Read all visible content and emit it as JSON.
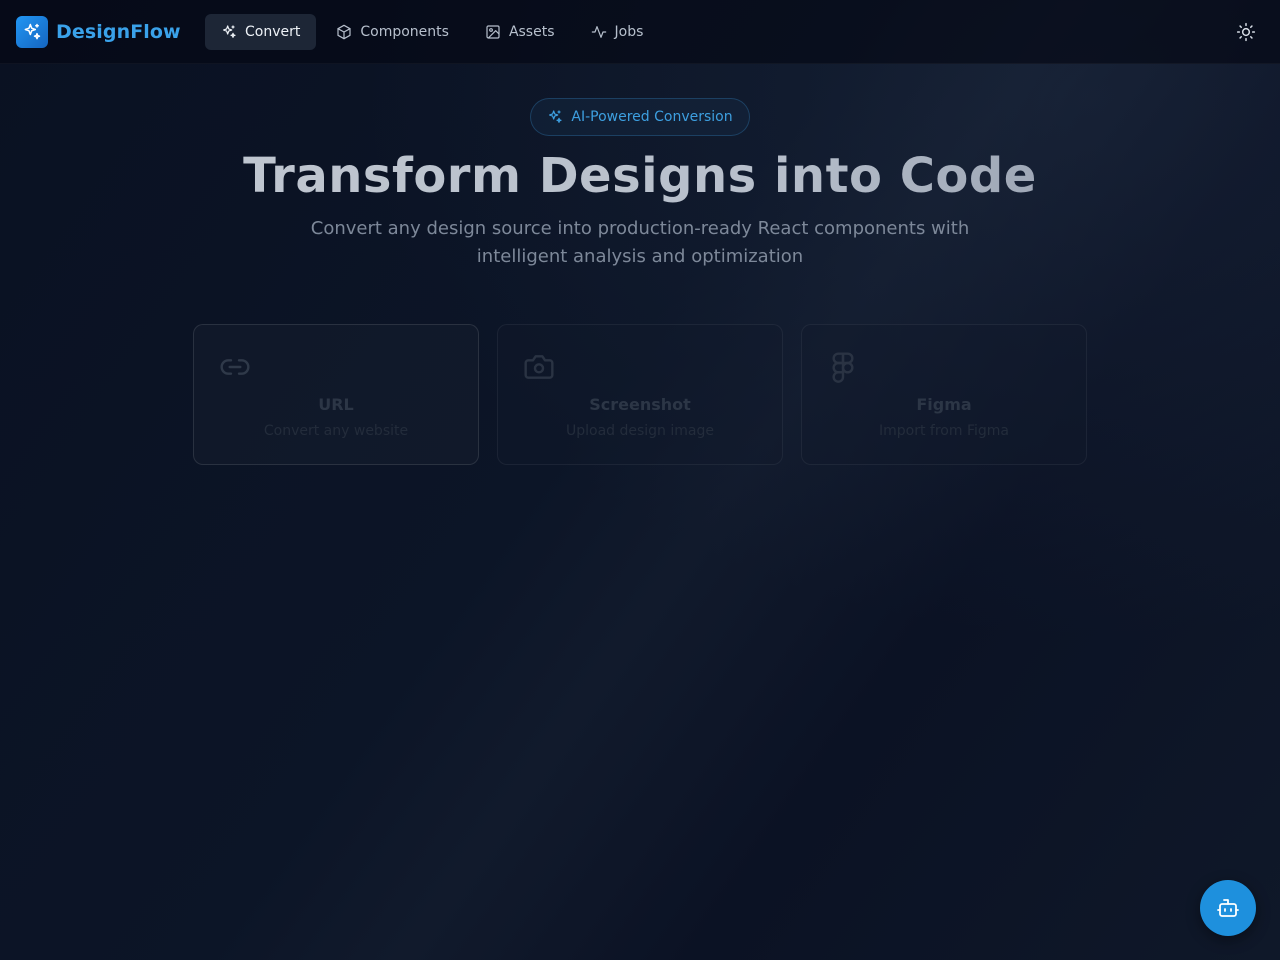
{
  "app": {
    "name": "DesignFlow",
    "accent": "#3aa2ea"
  },
  "nav": {
    "items": [
      {
        "label": "Convert",
        "icon": "sparkles-icon",
        "active": true
      },
      {
        "label": "Components",
        "icon": "cube-icon",
        "active": false
      },
      {
        "label": "Assets",
        "icon": "image-icon",
        "active": false
      },
      {
        "label": "Jobs",
        "icon": "activity-icon",
        "active": false
      }
    ]
  },
  "theme_toggle": {
    "icon": "sun-icon"
  },
  "hero": {
    "badge": "AI-Powered Conversion",
    "title": "Transform Designs into Code",
    "subtitle": "Convert any design source into production-ready React components with intelligent analysis and optimization"
  },
  "sources": [
    {
      "title": "URL",
      "description": "Convert any website",
      "icon": "link-icon",
      "selected": true
    },
    {
      "title": "Screenshot",
      "description": "Upload design image",
      "icon": "camera-icon",
      "selected": false
    },
    {
      "title": "Figma",
      "description": "Import from Figma",
      "icon": "figma-icon",
      "selected": false
    }
  ],
  "assistant_button": {
    "icon": "bot-icon",
    "color": "#1e90dd"
  }
}
